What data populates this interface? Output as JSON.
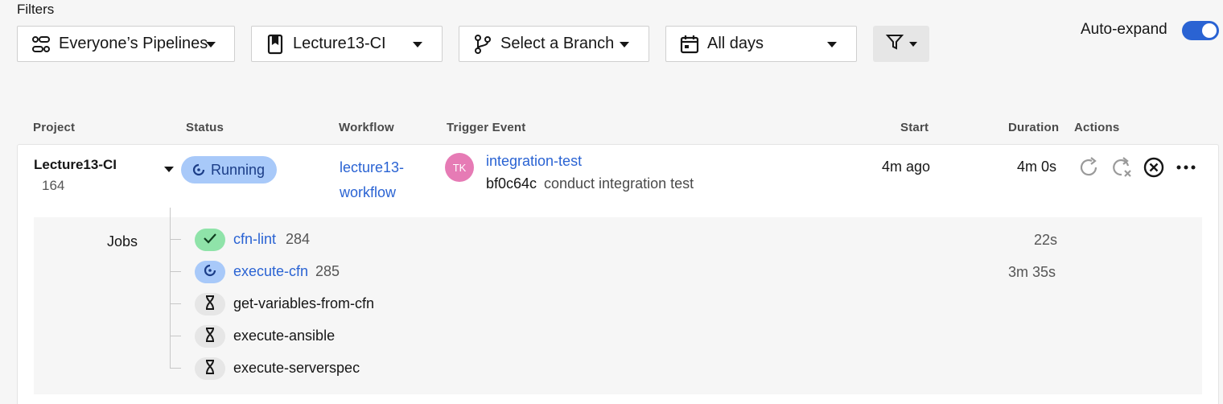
{
  "filters": {
    "title": "Filters",
    "pipelines": "Everyone’s Pipelines",
    "project": "Lecture13-CI",
    "branch": "Select a Branch",
    "days": "All days",
    "auto_expand_label": "Auto-expand",
    "auto_expand_on": true
  },
  "columns": {
    "project": "Project",
    "status": "Status",
    "workflow": "Workflow",
    "trigger": "Trigger Event",
    "start": "Start",
    "duration": "Duration",
    "actions": "Actions"
  },
  "pipeline": {
    "project": "Lecture13-CI",
    "number": "164",
    "status": "Running",
    "workflow_line1": "lecture13-",
    "workflow_line2": "workflow",
    "avatar_initials": "TK",
    "trigger_name": "integration-test",
    "commit_sha": "bf0c64c",
    "commit_msg": "conduct integration test",
    "start": "4m ago",
    "duration": "4m 0s"
  },
  "jobs": {
    "label": "Jobs",
    "items": [
      {
        "name": "cfn-lint",
        "number": "284",
        "duration": "22s",
        "status": "success"
      },
      {
        "name": "execute-cfn",
        "number": "285",
        "duration": "3m 35s",
        "status": "running"
      },
      {
        "name": "get-variables-from-cfn",
        "number": "",
        "duration": "",
        "status": "queued"
      },
      {
        "name": "execute-ansible",
        "number": "",
        "duration": "",
        "status": "queued"
      },
      {
        "name": "execute-serverspec",
        "number": "",
        "duration": "",
        "status": "queued"
      }
    ]
  },
  "colors": {
    "accent": "#2a63d3",
    "running_bg": "#a8c9f9",
    "success_bg": "#8fe3a9",
    "queued_bg": "#e6e6e6",
    "avatar_bg": "#e67bb5"
  }
}
